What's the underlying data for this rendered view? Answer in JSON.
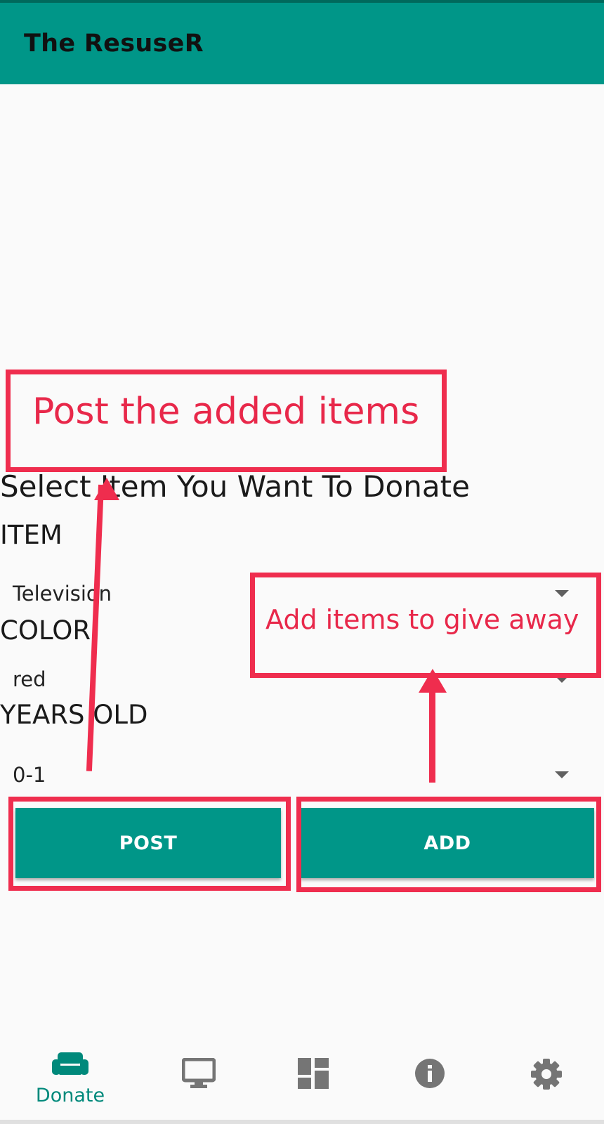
{
  "app": {
    "title": "The ResuseR"
  },
  "form": {
    "heading": "Select Item You Want To Donate",
    "item": {
      "label": "ITEM",
      "value": "Television"
    },
    "color": {
      "label": "COLOR",
      "value": "red"
    },
    "years_old": {
      "label": "YEARS OLD",
      "value": "0-1"
    }
  },
  "buttons": {
    "post": "POST",
    "add": "ADD"
  },
  "annotations": {
    "post_note": "Post the added items",
    "add_note": "Add items to give away"
  },
  "bottom_nav": [
    {
      "label": "Donate",
      "icon": "sofa-icon",
      "selected": true
    },
    {
      "label": "",
      "icon": "monitor-icon",
      "selected": false
    },
    {
      "label": "",
      "icon": "dashboard-icon",
      "selected": false
    },
    {
      "label": "",
      "icon": "info-icon",
      "selected": false
    },
    {
      "label": "",
      "icon": "gear-icon",
      "selected": false
    }
  ],
  "colors": {
    "primary": "#009688",
    "primary_dark": "#00695c",
    "annotation": "#ef2d4e",
    "nav_active": "#00897b",
    "nav_inactive": "#757575"
  }
}
